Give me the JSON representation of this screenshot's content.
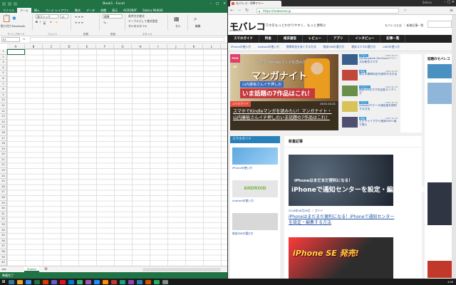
{
  "excel": {
    "title": "Book1 - Excel",
    "user": "Satoru MUKAE",
    "tabs": [
      "ファイル",
      "ホーム",
      "挿入",
      "ページ レイアウト",
      "数式",
      "データ",
      "校閲",
      "表示",
      "ACROBAT",
      "Satoru MUKAE"
    ],
    "active_tab": "ホーム",
    "ribbon": {
      "paste_label": "貼り付け",
      "clipboard_label": "クリップボード",
      "bluetooth_label": "Bluetooth",
      "font_name": "游ゴシック",
      "font_size": "11",
      "font_group": "フォント",
      "align_group": "配置",
      "number_format": "標準",
      "number_group": "数値",
      "cond_format": "条件付き書式",
      "table_format": "テーブルとして書式設定",
      "cell_style": "セルのスタイル",
      "style_group": "スタイル",
      "cells_label": "セル",
      "edit_label": "編集"
    },
    "name_box": "A1",
    "columns": [
      "A",
      "B",
      "C",
      "D",
      "E",
      "F",
      "G",
      "H",
      "I",
      "J",
      "K",
      "L",
      "M"
    ],
    "rows": [
      "1",
      "2",
      "3",
      "4",
      "5",
      "6",
      "7",
      "8",
      "9",
      "10",
      "11",
      "12",
      "13",
      "14",
      "15",
      "16",
      "17",
      "18",
      "19",
      "20",
      "21",
      "22",
      "23",
      "24",
      "25",
      "26",
      "27",
      "28",
      "29",
      "30",
      "31",
      "32",
      "33",
      "34",
      "35",
      "36",
      "37",
      "38",
      "39",
      "40"
    ],
    "sheet_tab": "Sheet1",
    "status": "準備完了"
  },
  "chrome": {
    "tab_title": "モバレコ - SIMフリー",
    "url": "https://mobareco.jp",
    "user": "Satoru"
  },
  "site": {
    "logo": "モバレコ",
    "logo_sub": "MOBA RECO",
    "tagline": "スマホをもっとわかりやすく、もっと便利に",
    "header_links": "モバレコとは ｜ 新着記事一覧",
    "nav": [
      "スマホガイド",
      "料金",
      "格安通信",
      "レビュー",
      "アプリ",
      "インタビュー",
      "記事一覧"
    ],
    "subnav": [
      "iPhoneの使い方",
      "Androidの使い方",
      "携帯料金を安くする方法",
      "格安SIMの選び方",
      "格安スマホの選び方",
      "LINEの使い方"
    ],
    "hero": {
      "badge": "PICK UP",
      "line1": "スマホでKindleマンガを読みたい",
      "line2": "マンガナイト",
      "line3": "山内康裕さんイチ押しの",
      "line4": "いま話題の7作品はこれ！",
      "category": "スマホガイド",
      "date": "2015.10.21",
      "caption": "スマホでKindleマンガを読みたい！マンガナイト・山内康裕さんイチ押しのいま話題の7作品はこれ！"
    },
    "side_articles": [
      {
        "badge": "アプリ",
        "text": "ASUSmobile ZenFoneシリーズの新作スマホ",
        "date": "2015.10.21"
      },
      {
        "badge": "料金",
        "text": "毎月の携帯料金を節約する方法",
        "date": "2015.10.20"
      },
      {
        "badge": "レビュー",
        "text": "格安SIMおすすめ比較ランキング",
        "date": "2015.10.19"
      },
      {
        "badge": "アプリ",
        "text": "Androidでデータ通信量を節約する方法",
        "date": "2015.10.19"
      },
      {
        "badge": "料金",
        "text": "大手キャリアから格安SIMへ乗り換え",
        "date": "2015.10.18"
      }
    ],
    "right_title": "話題のモバレコ",
    "left_col": {
      "header": "スマホガイド",
      "items": [
        "iPhoneの使い方",
        "Androidの使い方",
        "格安SIMの選び方"
      ]
    },
    "main": {
      "header": "新着記事",
      "img_text1": "iPhoneはまだまだ便利になる！",
      "img_text2": "iPhoneで通知センターを設定・編集する方法",
      "meta": "2016年06月28日 ｜ ガイド",
      "article": "iPhoneはまだまだ便利になる！iPhoneで通知センターを設定・編集する方法",
      "img2_text": "iPhone SE 発売!"
    }
  },
  "taskbar": {
    "time": "4:00",
    "colors": [
      "#2d7d9a",
      "#f0a030",
      "#3a8ee6",
      "#217346",
      "#d83b01",
      "#6a5acd",
      "#e81123",
      "#0078d7",
      "#3cb371",
      "#9b59b6",
      "#1e90ff",
      "#ff8c00",
      "#c0392b",
      "#16a085",
      "#8e44ad",
      "#2980b9",
      "#d35400",
      "#27ae60",
      "#7f8c8d"
    ]
  }
}
